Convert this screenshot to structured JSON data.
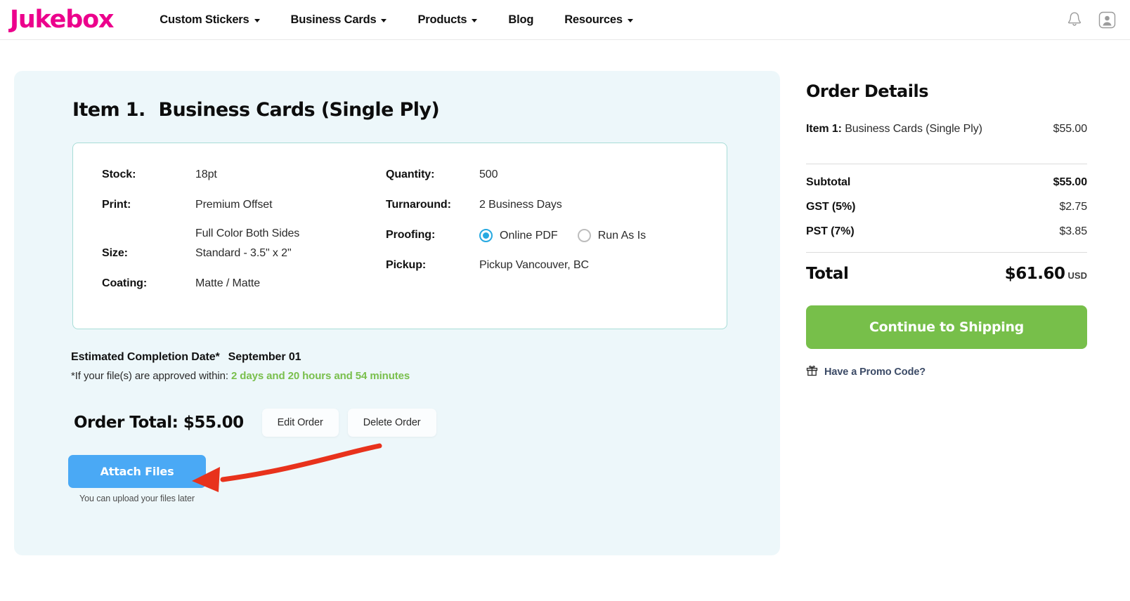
{
  "header": {
    "logo": "Jukebox",
    "nav": [
      {
        "label": "Custom Stickers",
        "has_caret": true
      },
      {
        "label": "Business Cards",
        "has_caret": true
      },
      {
        "label": "Products",
        "has_caret": true
      },
      {
        "label": "Blog",
        "has_caret": false
      },
      {
        "label": "Resources",
        "has_caret": true
      }
    ],
    "icons": [
      {
        "name": "notification-bell-icon"
      },
      {
        "name": "user-account-icon"
      }
    ]
  },
  "item": {
    "number_label": "Item 1.",
    "title": "Business Cards (Single Ply)",
    "specs_left": [
      {
        "label": "Stock:",
        "value": "18pt",
        "sub": ""
      },
      {
        "label": "Print:",
        "value": "Premium Offset",
        "sub": "Full Color Both Sides"
      },
      {
        "label": "Size:",
        "value": "Standard - 3.5\" x 2\"",
        "sub": ""
      },
      {
        "label": "Coating:",
        "value": "Matte / Matte",
        "sub": ""
      }
    ],
    "specs_right": [
      {
        "label": "Quantity:",
        "value": "500"
      },
      {
        "label": "Turnaround:",
        "value": "2 Business Days"
      },
      {
        "label": "Pickup:",
        "value": "Pickup Vancouver, BC"
      }
    ],
    "proofing": {
      "label": "Proofing:",
      "options": [
        {
          "label": "Online PDF",
          "selected": true
        },
        {
          "label": "Run As Is",
          "selected": false
        }
      ]
    },
    "estimated": {
      "label": "Estimated Completion Date*",
      "date": "September  01",
      "note_prefix": "*If your file(s) are approved within: ",
      "countdown": "2 days and 20 hours and 54 minutes"
    },
    "order_total_label": "Order Total: $55.00",
    "edit_button": "Edit Order",
    "delete_button": "Delete Order",
    "attach_button": "Attach Files",
    "attach_note": "You can upload your files later"
  },
  "order_details": {
    "title": "Order Details",
    "line_item": {
      "item_label": "Item 1:",
      "name": "Business Cards (Single Ply)",
      "amount": "$55.00"
    },
    "rows": [
      {
        "label": "Subtotal",
        "value": "$55.00",
        "bold": true
      },
      {
        "label": "GST (5%)",
        "value": "$2.75",
        "bold": false
      },
      {
        "label": "PST (7%)",
        "value": "$3.85",
        "bold": false
      }
    ],
    "total": {
      "label": "Total",
      "value": "$61.60",
      "currency": "USD"
    },
    "cta": "Continue to Shipping",
    "promo": "Have a Promo Code?",
    "promo_icon": "gift-icon"
  },
  "colors": {
    "brand_pink": "#ec008c",
    "panel_bg": "#edf7fa",
    "card_border": "#a8ddd7",
    "radio_accent": "#27a9e1",
    "attach_blue": "#4aa9f5",
    "cta_green": "#77bf4a",
    "countdown_green": "#79bf4c",
    "promo_text": "#3b4a66",
    "annotation_red": "#e8321c"
  }
}
